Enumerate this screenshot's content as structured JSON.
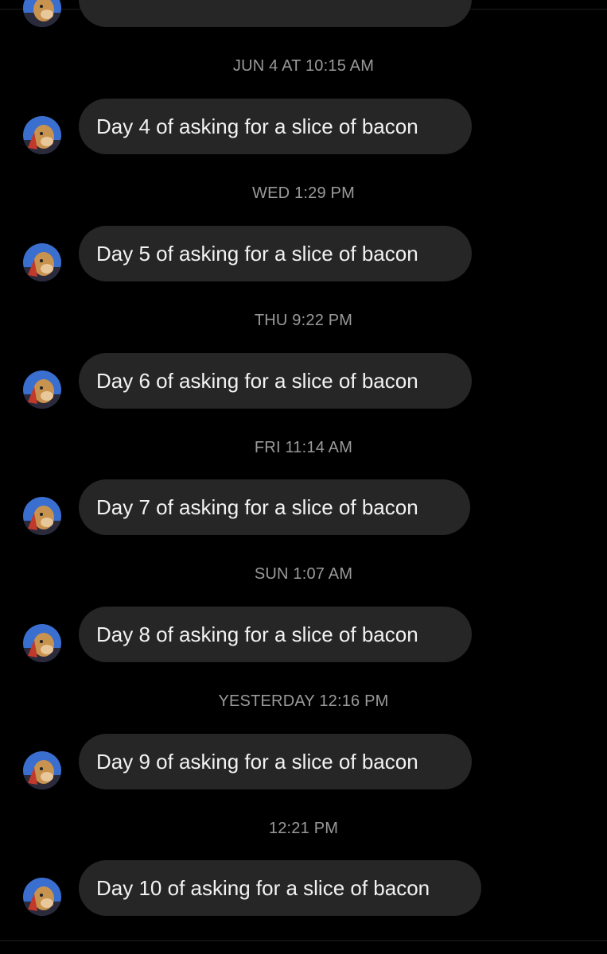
{
  "conversation": {
    "partial_message": {
      "avatar_icon": "dog-avatar-icon"
    },
    "messages": [
      {
        "timestamp": "JUN 4 AT 10:15 AM",
        "text": "Day 4 of asking for a slice of bacon"
      },
      {
        "timestamp": "WED 1:29 PM",
        "text": "Day 5 of asking for a slice of bacon"
      },
      {
        "timestamp": "THU 9:22 PM",
        "text": "Day 6 of asking for a slice of bacon"
      },
      {
        "timestamp": "FRI 11:14 AM",
        "text": "Day 7 of asking for a slice of bacon"
      },
      {
        "timestamp": "SUN 1:07 AM",
        "text": "Day 8 of asking for a slice of bacon"
      },
      {
        "timestamp": "YESTERDAY 12:16 PM",
        "text": "Day 9 of asking for a slice of bacon"
      },
      {
        "timestamp": "12:21 PM",
        "text": "Day 10 of asking for a slice of bacon"
      }
    ]
  },
  "colors": {
    "background": "#000000",
    "bubble": "#262626",
    "message_text": "#f2f2f2",
    "timestamp_text": "#9a9a9a"
  }
}
